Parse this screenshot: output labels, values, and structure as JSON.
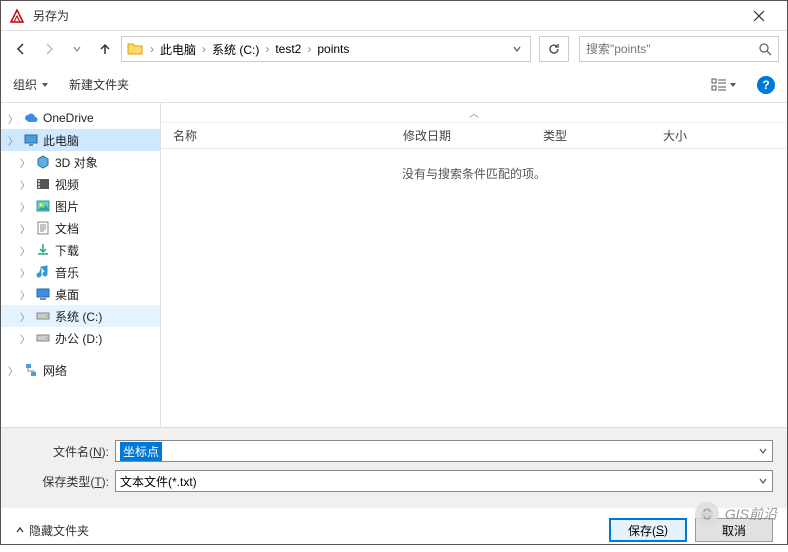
{
  "window": {
    "title": "另存为"
  },
  "nav": {
    "breadcrumb": [
      "此电脑",
      "系统 (C:)",
      "test2",
      "points"
    ],
    "search_placeholder": "搜索\"points\""
  },
  "toolbar": {
    "organize": "组织",
    "new_folder": "新建文件夹"
  },
  "tree": {
    "items": [
      {
        "icon": "cloud",
        "label": "OneDrive",
        "expandable": true,
        "indent": 0
      },
      {
        "icon": "pc",
        "label": "此电脑",
        "expandable": true,
        "indent": 0,
        "selected": true
      },
      {
        "icon": "3d",
        "label": "3D 对象",
        "expandable": true,
        "indent": 1
      },
      {
        "icon": "video",
        "label": "视频",
        "expandable": true,
        "indent": 1
      },
      {
        "icon": "picture",
        "label": "图片",
        "expandable": true,
        "indent": 1
      },
      {
        "icon": "doc",
        "label": "文档",
        "expandable": true,
        "indent": 1
      },
      {
        "icon": "download",
        "label": "下载",
        "expandable": true,
        "indent": 1
      },
      {
        "icon": "music",
        "label": "音乐",
        "expandable": true,
        "indent": 1
      },
      {
        "icon": "desktop",
        "label": "桌面",
        "expandable": true,
        "indent": 1
      },
      {
        "icon": "drive",
        "label": "系统 (C:)",
        "expandable": true,
        "indent": 1,
        "hover": true
      },
      {
        "icon": "drive",
        "label": "办公 (D:)",
        "expandable": true,
        "indent": 1
      },
      {
        "icon": "network",
        "label": "网络",
        "expandable": true,
        "indent": 0
      }
    ]
  },
  "columns": {
    "name": "名称",
    "date": "修改日期",
    "type": "类型",
    "size": "大小"
  },
  "empty_message": "没有与搜索条件匹配的项。",
  "form": {
    "filename_label_pre": "文件名(",
    "filename_label_key": "N",
    "filename_label_post": "):",
    "filename_value": "坐标点",
    "filetype_label_pre": "保存类型(",
    "filetype_label_key": "T",
    "filetype_label_post": "):",
    "filetype_value": "文本文件(*.txt)"
  },
  "footer": {
    "hide_folders": "隐藏文件夹",
    "save_pre": "保存(",
    "save_key": "S",
    "save_post": ")",
    "cancel": "取消"
  },
  "watermark": "GIS前沿"
}
